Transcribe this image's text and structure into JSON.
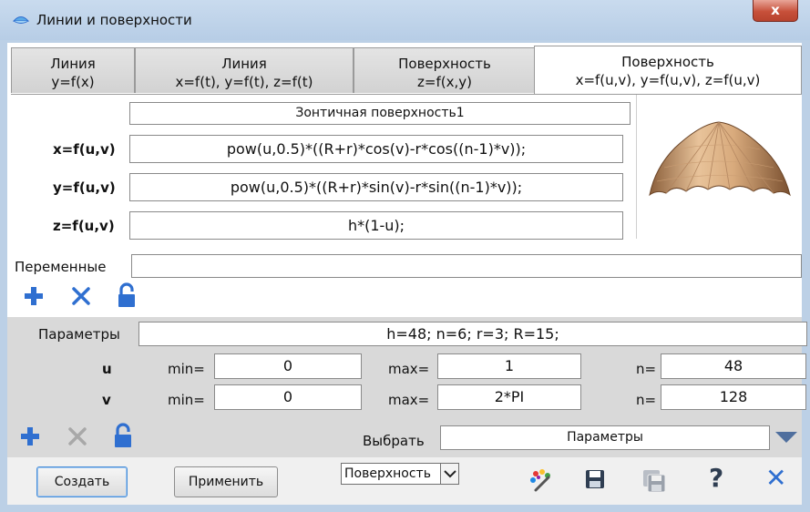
{
  "window": {
    "title": "Линии и поверхности",
    "close_glyph": "x",
    "app_icon": "surface-app-icon"
  },
  "tabs": [
    {
      "line1": "Линия",
      "line2": "y=f(x)",
      "active": false
    },
    {
      "line1": "Линия",
      "line2": "x=f(t), y=f(t), z=f(t)",
      "active": false
    },
    {
      "line1": "Поверхность",
      "line2": "z=f(x,y)",
      "active": false
    },
    {
      "line1": "Поверхность",
      "line2": "x=f(u,v), y=f(u,v), z=f(u,v)",
      "active": true
    }
  ],
  "surface": {
    "name": "Зонтичная поверхность1",
    "x_label": "x=f(u,v)",
    "x_value": "pow(u,0.5)*((R+r)*cos(v)-r*cos((n-1)*v));",
    "y_label": "y=f(u,v)",
    "y_value": "pow(u,0.5)*((R+r)*sin(v)-r*sin((n-1)*v));",
    "z_label": "z=f(u,v)",
    "z_value": "h*(1-u);",
    "preview_icon": "umbrella-surface-preview"
  },
  "variables": {
    "label": "Переменные",
    "value": ""
  },
  "parameters": {
    "label": "Параметры",
    "value": "h=48; n=6; r=3; R=15;",
    "u": {
      "label": "u",
      "min_label": "min=",
      "min": "0",
      "max_label": "max=",
      "max": "1",
      "n_label": "n=",
      "n": "48"
    },
    "v": {
      "label": "v",
      "min_label": "min=",
      "min": "0",
      "max_label": "max=",
      "max": "2*PI",
      "n_label": "n=",
      "n": "128"
    },
    "choose_label": "Выбрать",
    "choose_value": "Параметры"
  },
  "footer": {
    "create_label": "Создать",
    "apply_label": "Применить",
    "type_select": "Поверхность",
    "icons": [
      "palette-icon",
      "save-icon",
      "save-as-icon",
      "help-icon",
      "close-icon"
    ],
    "help_glyph": "?",
    "close_glyph": "✕"
  },
  "colors": {
    "accent_blue": "#2f6fd0",
    "disabled_gray": "#a8a8a8",
    "lock_blue": "#2f6fd0"
  }
}
